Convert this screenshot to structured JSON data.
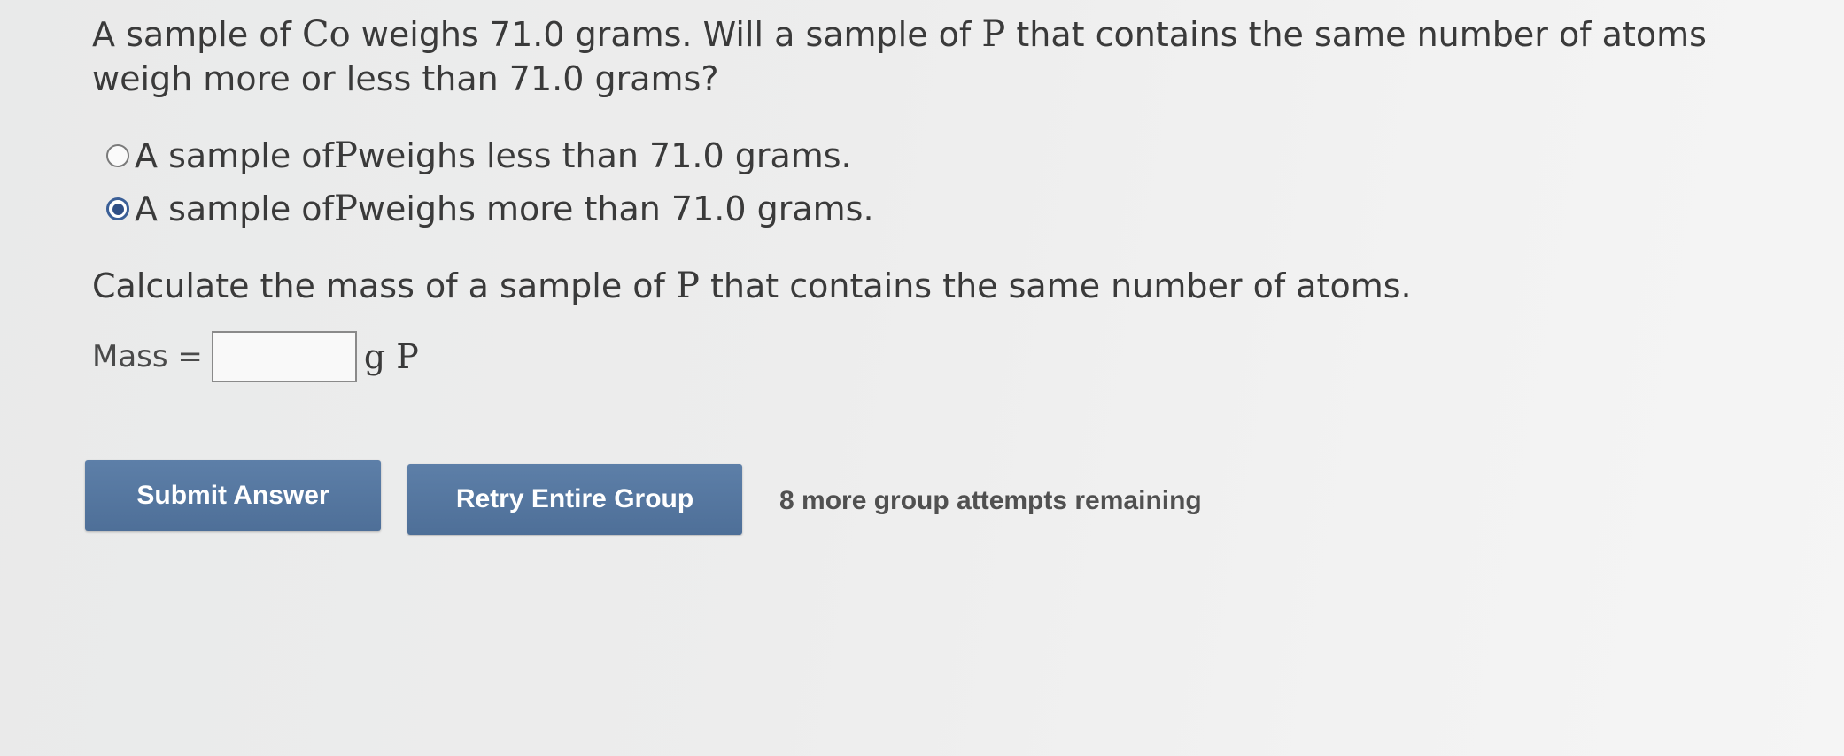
{
  "question": {
    "part1": "A sample of ",
    "element1": "Co",
    "part2": " weighs 71.0 grams. Will a sample of ",
    "element2": "P",
    "part3": " that contains the same number of atoms weigh more or less than 71.0 grams?"
  },
  "options": [
    {
      "before": "A sample of ",
      "element": "P",
      "after": " weighs less than 71.0 grams.",
      "selected": false
    },
    {
      "before": "A sample of ",
      "element": "P",
      "after": " weighs more than 71.0 grams.",
      "selected": true
    }
  ],
  "calculate": {
    "before": "Calculate the mass of a sample of ",
    "element": "P",
    "after": " that contains the same number of atoms."
  },
  "mass": {
    "label": "Mass =",
    "value": "",
    "unit": "g P"
  },
  "buttons": {
    "submit": "Submit Answer",
    "retry": "Retry Entire Group"
  },
  "attempts_text": "8 more group attempts remaining",
  "colors": {
    "button_bg": "#5673a0",
    "radio_selected": "#2f4f86"
  }
}
